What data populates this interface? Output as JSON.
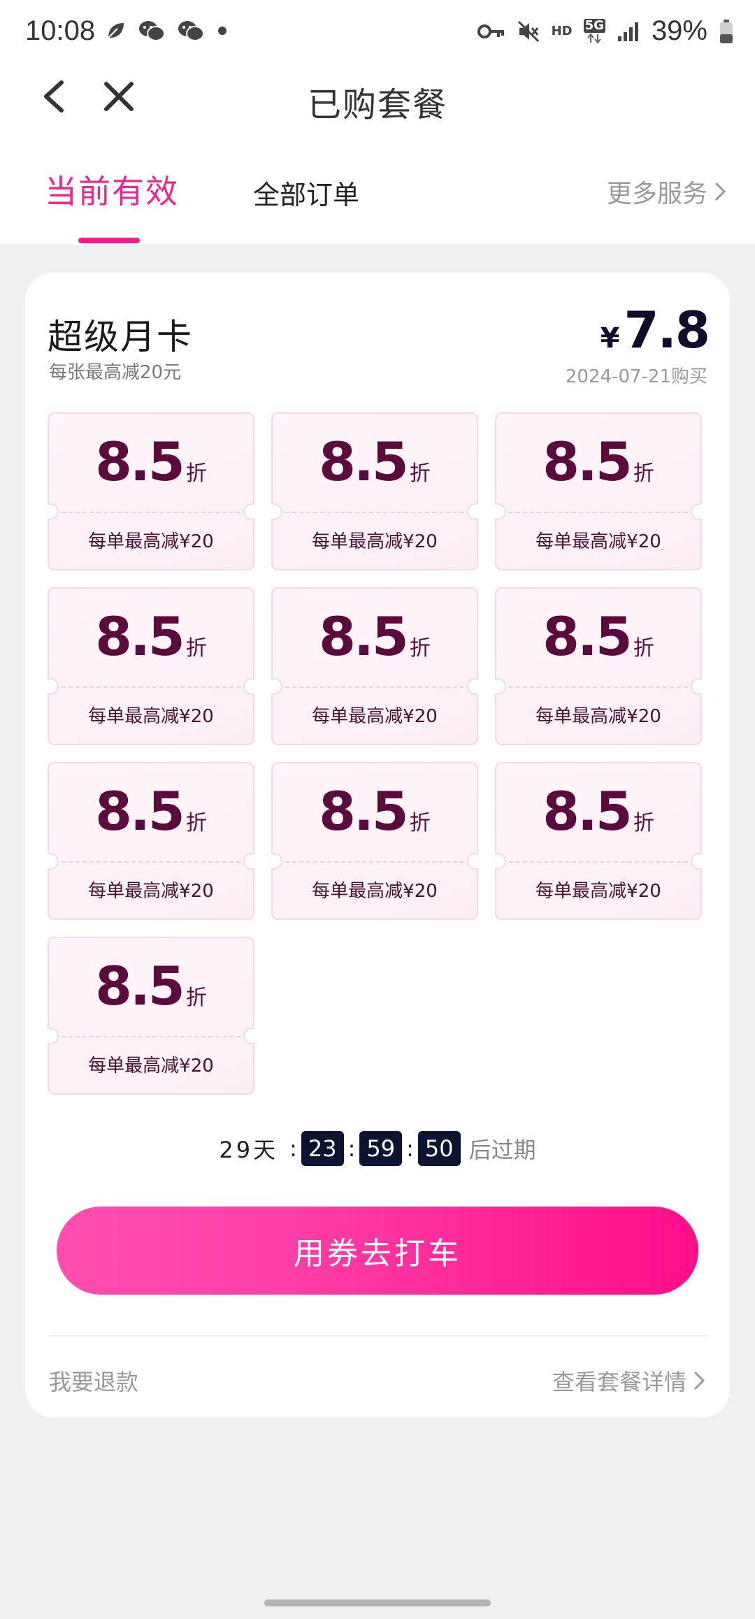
{
  "status_bar": {
    "time": "10:08",
    "battery_percent": "39%",
    "network_label": "5G",
    "hd_label": "HD",
    "left_icons": [
      "leaf-icon",
      "wechat-icon",
      "wechat-icon",
      "dot-icon"
    ],
    "right_icons": [
      "key-icon",
      "mute-icon",
      "hd-icon",
      "5g-icon",
      "signal-icon",
      "battery-icon"
    ]
  },
  "nav": {
    "title": "已购套餐"
  },
  "tabs": {
    "current": "当前有效",
    "all": "全部订单",
    "more": "更多服务"
  },
  "package": {
    "name": "超级月卡",
    "description": "每张最高减20元",
    "currency": "¥",
    "price": "7.8",
    "purchase_date": "2024-07-21购买"
  },
  "coupons": [
    {
      "discount": "8.5",
      "unit": "折",
      "limit": "每单最高减¥20"
    },
    {
      "discount": "8.5",
      "unit": "折",
      "limit": "每单最高减¥20"
    },
    {
      "discount": "8.5",
      "unit": "折",
      "limit": "每单最高减¥20"
    },
    {
      "discount": "8.5",
      "unit": "折",
      "limit": "每单最高减¥20"
    },
    {
      "discount": "8.5",
      "unit": "折",
      "limit": "每单最高减¥20"
    },
    {
      "discount": "8.5",
      "unit": "折",
      "limit": "每单最高减¥20"
    },
    {
      "discount": "8.5",
      "unit": "折",
      "limit": "每单最高减¥20"
    },
    {
      "discount": "8.5",
      "unit": "折",
      "limit": "每单最高减¥20"
    },
    {
      "discount": "8.5",
      "unit": "折",
      "limit": "每单最高减¥20"
    },
    {
      "discount": "8.5",
      "unit": "折",
      "limit": "每单最高减¥20"
    }
  ],
  "countdown": {
    "days": "29天",
    "hours": "23",
    "minutes": "59",
    "seconds": "50",
    "suffix": "后过期"
  },
  "cta": {
    "label": "用券去打车"
  },
  "footer": {
    "refund": "我要退款",
    "detail": "查看套餐详情"
  },
  "colors": {
    "accent": "#ee1f8c",
    "coupon_text": "#5a0a3c",
    "countdown_box": "#0d1433"
  }
}
